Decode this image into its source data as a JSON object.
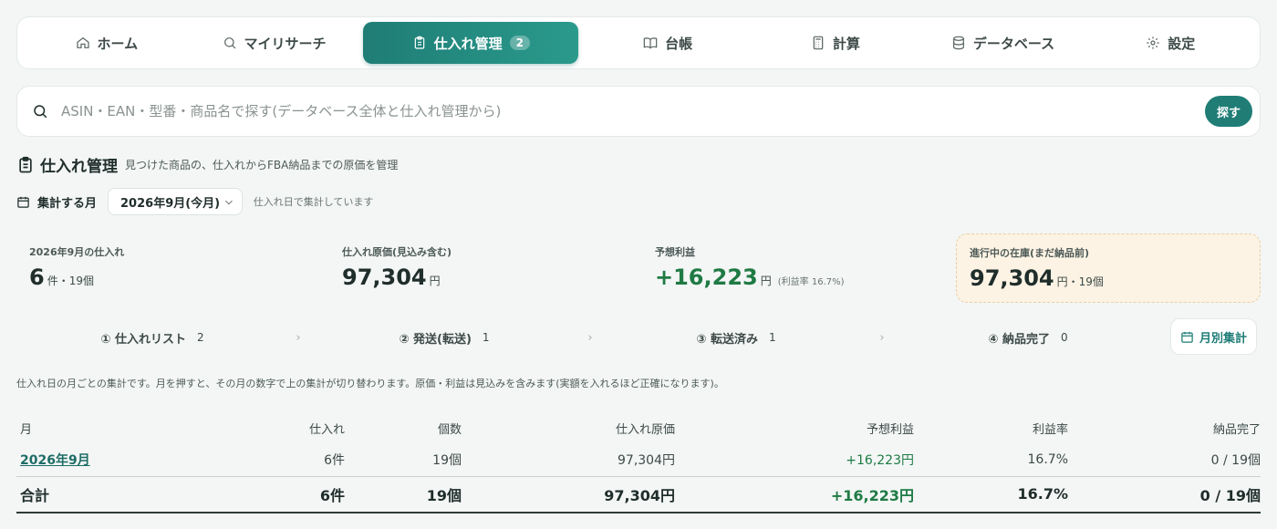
{
  "nav": {
    "items": [
      {
        "label": "ホーム",
        "icon": "home-icon"
      },
      {
        "label": "マイリサーチ",
        "icon": "search-icon"
      },
      {
        "label": "仕入れ管理",
        "icon": "clipboard-icon",
        "badge": "2",
        "active": true
      },
      {
        "label": "台帳",
        "icon": "book-icon"
      },
      {
        "label": "計算",
        "icon": "calculator-icon"
      },
      {
        "label": "データベース",
        "icon": "database-icon"
      },
      {
        "label": "設定",
        "icon": "gear-icon"
      }
    ]
  },
  "search": {
    "placeholder": "ASIN・EAN・型番・商品名で探す(データベース全体と仕入れ管理から)",
    "button": "探す"
  },
  "page": {
    "title": "仕入れ管理",
    "subtitle": "見つけた商品の、仕入れからFBA納品までの原価を管理"
  },
  "month": {
    "label": "集計する月",
    "selected": "2026年9月(今月)",
    "note": "仕入れ日で集計しています"
  },
  "kpis": {
    "purchases": {
      "title": "2026年9月の仕入れ",
      "value": "6",
      "unit": "件・19個"
    },
    "cost": {
      "title": "仕入れ原価(見込み含む)",
      "value": "97,304",
      "unit": "円"
    },
    "profit": {
      "title": "予想利益",
      "value": "+16,223",
      "unit": "円",
      "extra": "(利益率 16.7%)"
    },
    "stock": {
      "title": "進行中の在庫(まだ納品前)",
      "value": "97,304",
      "unit": "円・19個"
    }
  },
  "steps": [
    {
      "label": "① 仕入れリスト",
      "count": "2"
    },
    {
      "label": "② 発送(転送)",
      "count": "1"
    },
    {
      "label": "③ 転送済み",
      "count": "1"
    },
    {
      "label": "④ 納品完了",
      "count": "0"
    }
  ],
  "monthly_button": "月別集計",
  "explain": "仕入れ日の月ごとの集計です。月を押すと、その月の数字で上の集計が切り替わります。原価・利益は見込みを含みます(実額を入れるほど正確になります)。",
  "table": {
    "headers": [
      "月",
      "仕入れ",
      "個数",
      "仕入れ原価",
      "予想利益",
      "利益率",
      "納品完了"
    ],
    "rows": [
      [
        "2026年9月",
        "6件",
        "19個",
        "97,304円",
        "+16,223円",
        "16.7%",
        "0 / 19個"
      ]
    ],
    "total": [
      "合計",
      "6件",
      "19個",
      "97,304円",
      "+16,223円",
      "16.7%",
      "0 / 19個"
    ]
  },
  "colors": {
    "accent": "#1f7d76",
    "profit": "#1f7a44",
    "stock_bg": "#fdf3e4"
  }
}
